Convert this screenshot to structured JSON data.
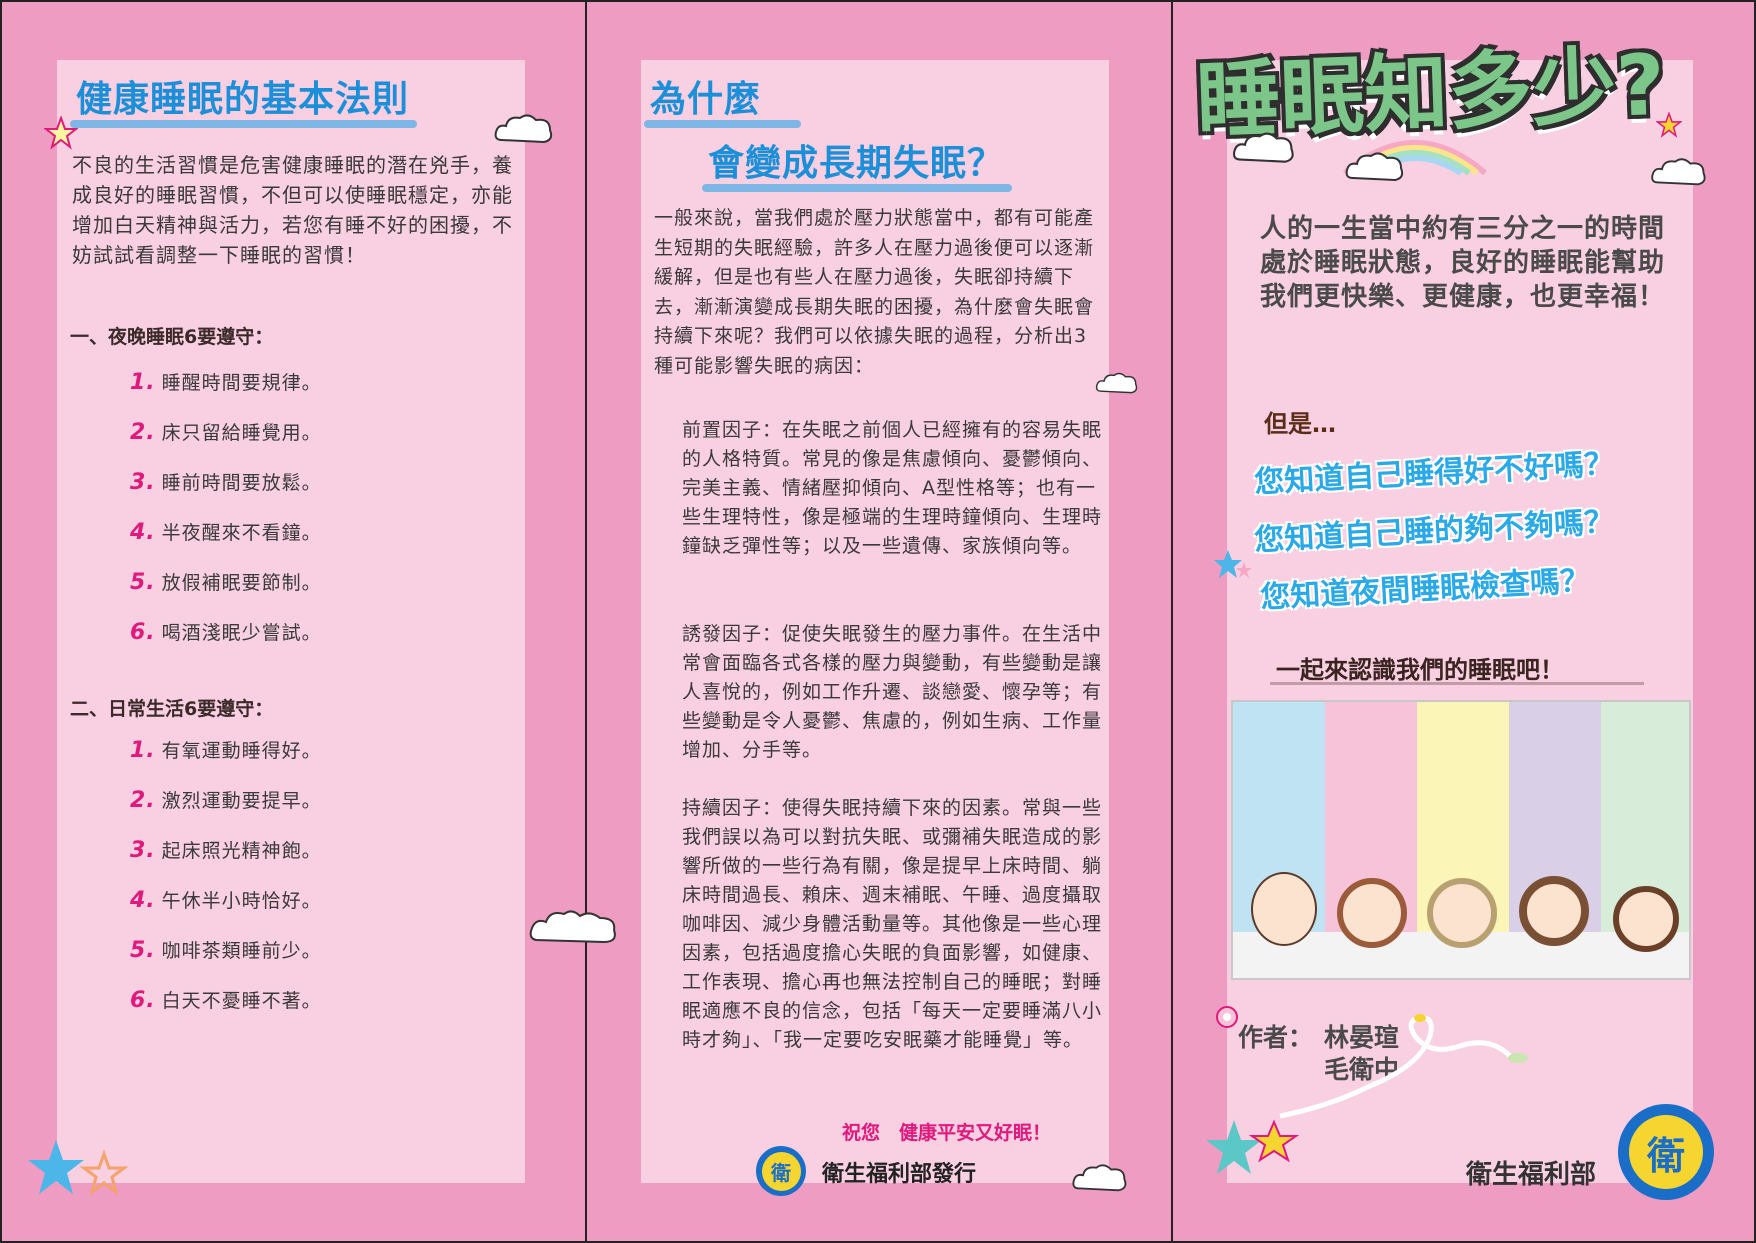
{
  "panel1": {
    "title": "健康睡眠的基本法則",
    "intro": "不良的生活習慣是危害健康睡眠的潛在兇手，養成良好的睡眠習慣，不但可以使睡眠穩定，亦能增加白天精神與活力，若您有睡不好的困擾，不妨試試看調整一下睡眠的習慣！",
    "section1": "一、夜晚睡眠6要遵守：",
    "list1": [
      {
        "n": "1.",
        "t": "睡醒時間要規律。"
      },
      {
        "n": "2.",
        "t": "床只留給睡覺用。"
      },
      {
        "n": "3.",
        "t": "睡前時間要放鬆。"
      },
      {
        "n": "4.",
        "t": "半夜醒來不看鐘。"
      },
      {
        "n": "5.",
        "t": "放假補眠要節制。"
      },
      {
        "n": "6.",
        "t": "喝酒淺眠少嘗試。"
      }
    ],
    "section2": "二、日常生活6要遵守：",
    "list2": [
      {
        "n": "1.",
        "t": "有氧運動睡得好。"
      },
      {
        "n": "2.",
        "t": "激烈運動要提早。"
      },
      {
        "n": "3.",
        "t": "起床照光精神飽。"
      },
      {
        "n": "4.",
        "t": "午休半小時恰好。"
      },
      {
        "n": "5.",
        "t": "咖啡茶類睡前少。"
      },
      {
        "n": "6.",
        "t": "白天不憂睡不著。"
      }
    ]
  },
  "panel2": {
    "title_line1": "為什麼",
    "title_line2": "會變成長期失眠？",
    "intro": "一般來說，當我們處於壓力狀態當中，都有可能產生短期的失眠經驗，許多人在壓力過後便可以逐漸緩解，但是也有些人在壓力過後，失眠卻持續下去，漸漸演變成長期失眠的困擾，為什麼會失眠會持續下來呢？我們可以依據失眠的過程，分析出3種可能影響失眠的病因：",
    "factor1": "前置因子：在失眠之前個人已經擁有的容易失眠的人格特質。常見的像是焦慮傾向、憂鬱傾向、完美主義、情緒壓抑傾向、A型性格等；也有一些生理特性，像是極端的生理時鐘傾向、生理時鐘缺乏彈性等；以及一些遺傳、家族傾向等。",
    "factor2": "誘發因子：促使失眠發生的壓力事件。在生活中常會面臨各式各樣的壓力與變動，有些變動是讓人喜悅的，例如工作升遷、談戀愛、懷孕等；有些變動是令人憂鬱、焦慮的，例如生病、工作量增加、分手等。",
    "factor3": "持續因子：使得失眠持續下來的因素。常與一些我們誤以為可以對抗失眠、或彌補失眠造成的影響所做的一些行為有關，像是提早上床時間、躺床時間過長、賴床、週末補眠、午睡、過度攝取咖啡因、減少身體活動量等。其他像是一些心理因素，包括過度擔心失眠的負面影響，如健康、工作表現、擔心再也無法控制自己的睡眠；對睡眠適應不良的信念，包括「每天一定要睡滿八小時才夠」、「我一定要吃安眠藥才能睡覺」等。",
    "blessing": "祝您　健康平安又好眠！",
    "publisher": "衛生福利部發行"
  },
  "panel3": {
    "title": "睡眠知多少?",
    "intro": "人的一生當中約有三分之一的時間處於睡眠狀態，良好的睡眠能幫助我們更快樂、更健康，也更幸福！",
    "but": "但是…",
    "questions": [
      "您知道自己睡得好不好嗎？",
      "您知道自己睡的夠不夠嗎？",
      "您知道夜間睡眠檢查嗎？"
    ],
    "cta": "一起來認識我們的睡眠吧！",
    "author_label": "作者：",
    "author1": "林晏瑄",
    "author2": "毛衛中",
    "org": "衛生福利部",
    "logo_char": "衛"
  },
  "colors": {
    "background": "#ef9cc3",
    "card": "#f9cfe2",
    "blue_heading": "#1b8fd8",
    "number_pink": "#e0197d",
    "title_green": "#7dc68a"
  }
}
